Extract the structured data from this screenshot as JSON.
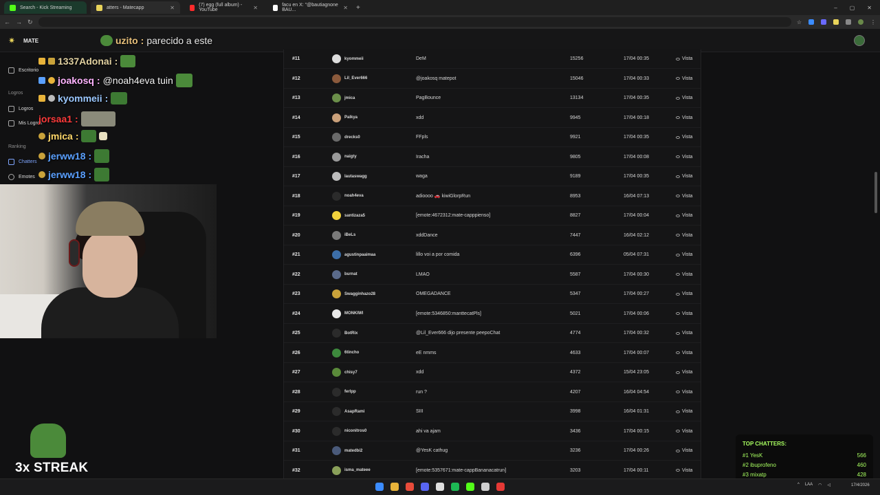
{
  "browser": {
    "tabs": [
      {
        "title": "Search - Kick Streaming",
        "fav_color": "#53fc18"
      },
      {
        "title": "atters - Matecapp",
        "fav_color": "#e8d35a"
      },
      {
        "title": "(7) egg (full album) - YouTube",
        "fav_color": "#ff2b2b"
      },
      {
        "title": "facu en X: \"@bautiagnone BAU...",
        "fav_color": "#ffffff"
      }
    ],
    "window_controls": [
      "–",
      "▢",
      "✕"
    ]
  },
  "app": {
    "brand": "MATE",
    "top_message": {
      "user": "uzito",
      "text": "parecido a este"
    }
  },
  "sidebar": {
    "items": [
      {
        "label": "Escritorio",
        "section": false
      },
      {
        "label": "Logros",
        "section": true
      },
      {
        "label": "Logros",
        "section": false
      },
      {
        "label": "Mis Logros",
        "section": false
      },
      {
        "label": "Ranking",
        "section": true
      },
      {
        "label": "Chatters",
        "section": false,
        "active": true
      },
      {
        "label": "Emotes",
        "section": false
      }
    ]
  },
  "chat": [
    {
      "user": "1337Adonai",
      "text": "",
      "color": "#e0d0a0"
    },
    {
      "user": "joakosq",
      "text": "@noah4eva tuin",
      "color": "#ffb3ff"
    },
    {
      "user": "kyommeii",
      "text": "",
      "color": "#9bc8ff"
    },
    {
      "user": "jorsaa1",
      "text": "",
      "color": "#ff3b3b"
    },
    {
      "user": "jmica",
      "text": "",
      "color": "#ffd86a"
    },
    {
      "user": "jerww18",
      "text": "",
      "color": "#5aa0ff"
    },
    {
      "user": "jerww18",
      "text": "",
      "color": "#5aa0ff"
    }
  ],
  "streak": "3x STREAK",
  "leaderboard": {
    "view_label": "Vista",
    "rows": [
      {
        "rank": "#11",
        "user": "kyommeii",
        "msg": "DeM",
        "count": "15256",
        "date": "17/04 00:35",
        "av": "#dddddd"
      },
      {
        "rank": "#12",
        "user": "Lil_Ever666",
        "msg": "@joakosq matepot",
        "count": "15046",
        "date": "17/04 00:33",
        "av": "#8b5a3c"
      },
      {
        "rank": "#13",
        "user": "jmica",
        "msg": "PagBounce",
        "count": "13134",
        "date": "17/04 00:35",
        "av": "#6b8f4a"
      },
      {
        "rank": "#14",
        "user": "Palkya",
        "msg": "xdd",
        "count": "9945",
        "date": "17/04 00:18",
        "av": "#caa07a"
      },
      {
        "rank": "#15",
        "user": "drecks0",
        "msg": "FFpls",
        "count": "9921",
        "date": "17/04 00:35",
        "av": "#6a6a6a"
      },
      {
        "rank": "#16",
        "user": "naigty",
        "msg": "Iracha",
        "count": "9805",
        "date": "17/04 00:08",
        "av": "#9a9a9a"
      },
      {
        "rank": "#17",
        "user": "lautaswagg",
        "msg": "waga",
        "count": "9189",
        "date": "17/04 00:35",
        "av": "#bdbdbd"
      },
      {
        "rank": "#18",
        "user": "noah4eva",
        "msg": "adioooo 🚗 kiwiGlorpRun",
        "count": "8953",
        "date": "16/04 07:13",
        "av": "#2b2b2b"
      },
      {
        "rank": "#19",
        "user": "santizaza5",
        "msg": "[emote:4672312:mate-capppienso]",
        "count": "8827",
        "date": "17/04 00:04",
        "av": "#f2d23c"
      },
      {
        "rank": "#20",
        "user": "iBeLs",
        "msg": "xddDance",
        "count": "7447",
        "date": "16/04 02:12",
        "av": "#7a7a7a"
      },
      {
        "rank": "#21",
        "user": "agustinpaaimaa",
        "msg": "lillo voi a por comida",
        "count": "6396",
        "date": "05/04 07:31",
        "av": "#3c6ea8"
      },
      {
        "rank": "#22",
        "user": "burnat",
        "msg": "LMAO",
        "count": "5587",
        "date": "17/04 00:30",
        "av": "#5a6a8a"
      },
      {
        "rank": "#23",
        "user": "Swagginhazo28",
        "msg": "OMEGADANCE",
        "count": "5347",
        "date": "17/04 00:27",
        "av": "#c9a23a"
      },
      {
        "rank": "#24",
        "user": "MONKIWI",
        "msg": "[emote:5346850:manttecatPls]",
        "count": "5021",
        "date": "17/04 00:06",
        "av": "#e8e8e8"
      },
      {
        "rank": "#25",
        "user": "BotRix",
        "msg": "@Lil_Ever666 dijo presente peepoChat",
        "count": "4774",
        "date": "17/04 00:32",
        "av": "#2b2b2b"
      },
      {
        "rank": "#26",
        "user": "6tincho",
        "msg": "eE nmms",
        "count": "4633",
        "date": "17/04 00:07",
        "av": "#3d8a3d"
      },
      {
        "rank": "#27",
        "user": "chisy7",
        "msg": "xdd",
        "count": "4372",
        "date": "15/04 23:05",
        "av": "#5a8a3a"
      },
      {
        "rank": "#28",
        "user": "ferlpp",
        "msg": "run ?",
        "count": "4207",
        "date": "16/04 04:54",
        "av": "#2b2b2b"
      },
      {
        "rank": "#29",
        "user": "AsapRami",
        "msg": "SIII",
        "count": "3998",
        "date": "16/04 01:31",
        "av": "#2b2b2b"
      },
      {
        "rank": "#30",
        "user": "niconitros0",
        "msg": "ahi va ajam",
        "count": "3436",
        "date": "17/04 00:15",
        "av": "#2b2b2b"
      },
      {
        "rank": "#31",
        "user": "matedbi2",
        "msg": "@YesK cathug",
        "count": "3236",
        "date": "17/04 00:26",
        "av": "#4a5a7a"
      },
      {
        "rank": "#32",
        "user": "isma_mateee",
        "msg": "[emote:5357671:mate-cappBananacatrun]",
        "count": "3203",
        "date": "17/04 00:11",
        "av": "#8aa05a"
      }
    ]
  },
  "top_chatters": {
    "title": "TOP CHATTERS:",
    "rows": [
      {
        "label": "#1 YesK",
        "value": "566"
      },
      {
        "label": "#2 ibuprofeno",
        "value": "460"
      },
      {
        "label": "#3 mixatp",
        "value": "428"
      }
    ]
  },
  "taskbar": {
    "icons": [
      {
        "name": "windows-icon",
        "color": "#3b8cff"
      },
      {
        "name": "folder-icon",
        "color": "#e8b33a"
      },
      {
        "name": "chrome-icon",
        "color": "#e84b3a"
      },
      {
        "name": "discord-icon",
        "color": "#5865f2"
      },
      {
        "name": "app-icon",
        "color": "#dddddd"
      },
      {
        "name": "spotify-icon",
        "color": "#1db954"
      },
      {
        "name": "kick-icon",
        "color": "#53fc18"
      },
      {
        "name": "ccleaner-icon",
        "color": "#cfcfcf"
      },
      {
        "name": "opera-icon",
        "color": "#e53935"
      }
    ],
    "lang": "LAA",
    "date": "17/4/2026"
  }
}
